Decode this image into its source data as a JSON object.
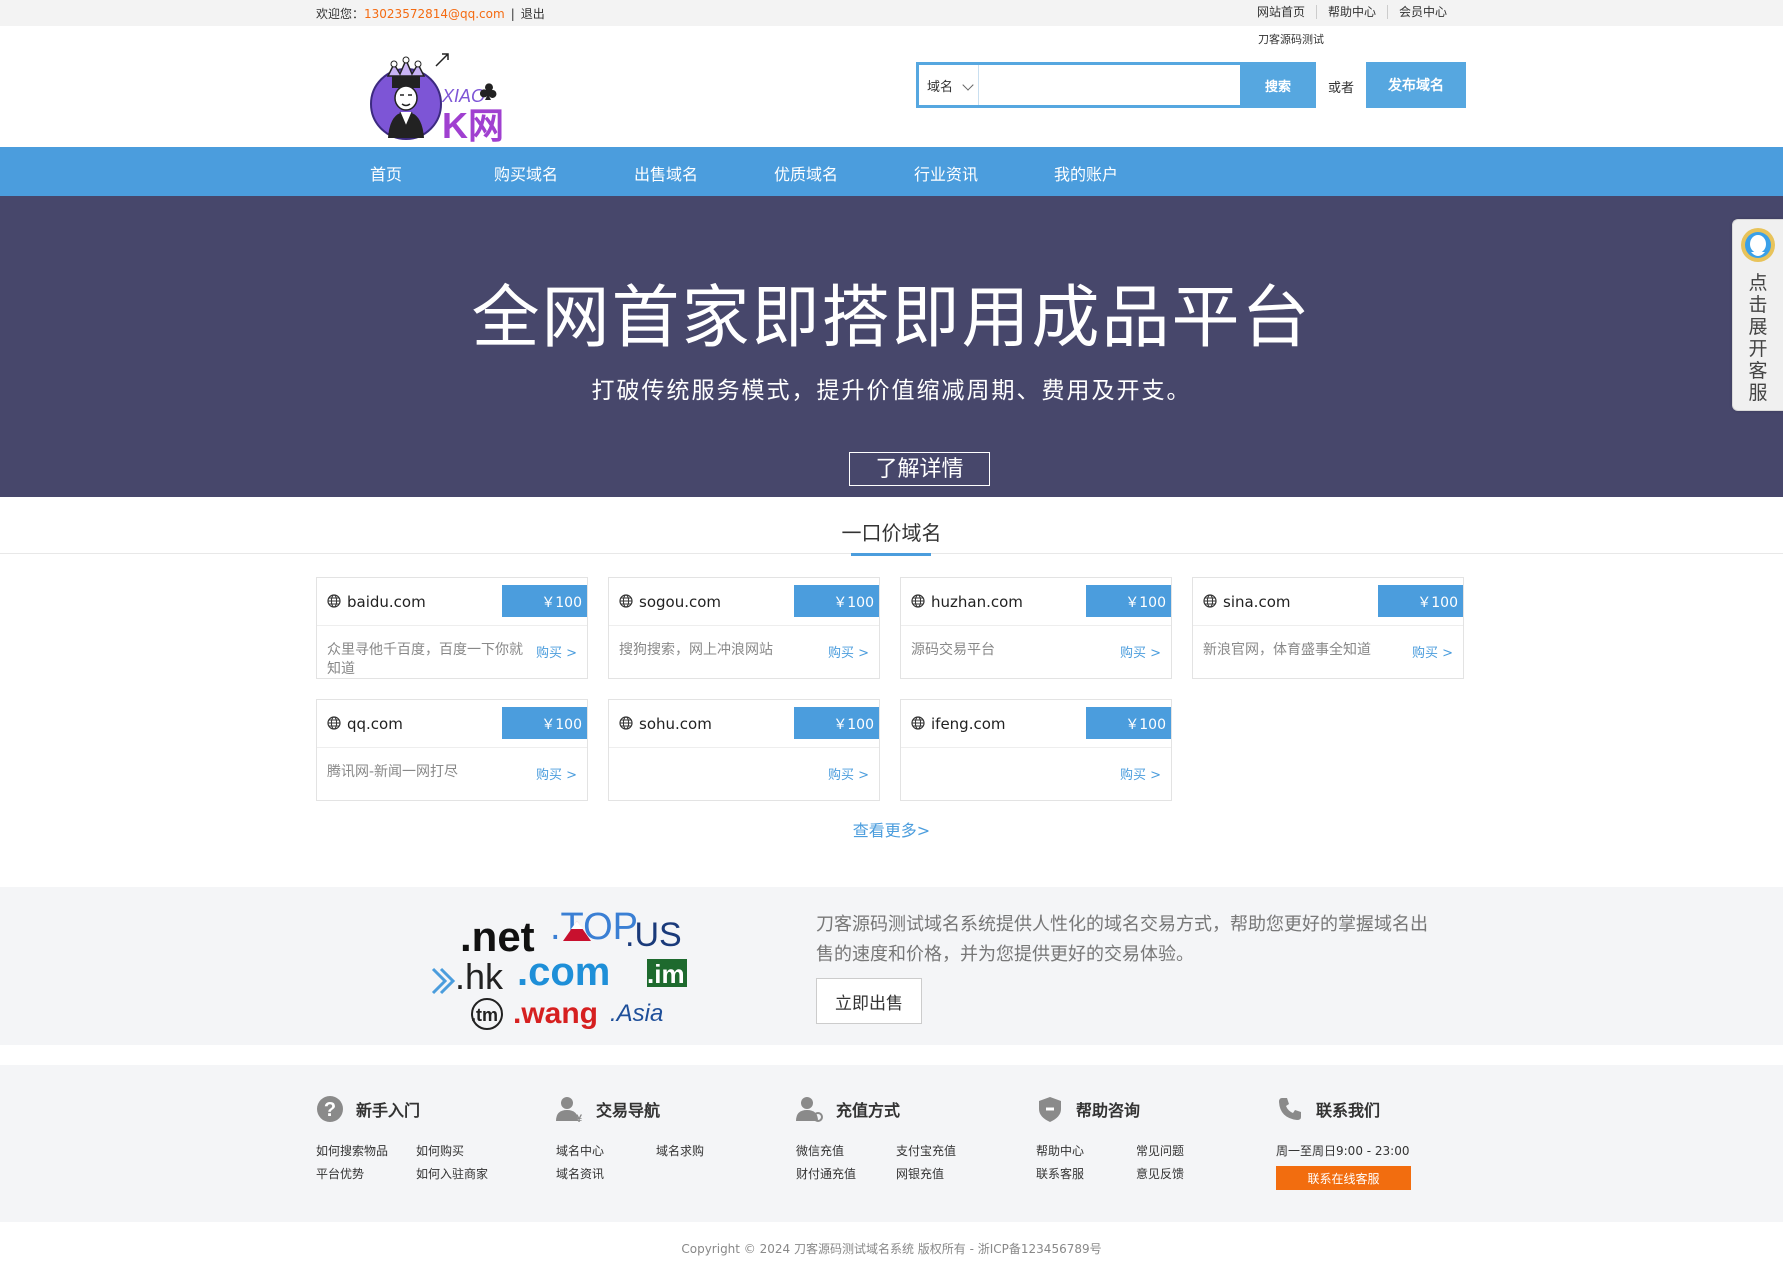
{
  "topbar": {
    "welcome": "欢迎您：",
    "email": "13023572814@qq.com",
    "separator": "|",
    "logout": "退出",
    "links": [
      "网站首页",
      "帮助中心",
      "会员中心"
    ]
  },
  "header": {
    "logo_text_top": "XIAO",
    "logo_text_main": "K网",
    "search_note": "刀客源码测试",
    "search_type": "域名",
    "search_value": "",
    "search_button": "搜索",
    "or_text": "或者",
    "publish_button": "发布域名"
  },
  "nav": {
    "items": [
      "首页",
      "购买域名",
      "出售域名",
      "优质域名",
      "行业资讯",
      "我的账户"
    ]
  },
  "banner": {
    "title": "全网首家即搭即用成品平台",
    "subtitle": "打破传统服务模式，提升价值缩减周期、费用及开支。",
    "button": "了解详情"
  },
  "section": {
    "title": "一口价域名",
    "see_more": "查看更多>"
  },
  "domains": [
    {
      "name": "baidu.com",
      "price": "￥100",
      "desc": "众里寻他千百度，百度一下你就知道",
      "buy": "购买 >"
    },
    {
      "name": "sogou.com",
      "price": "￥100",
      "desc": "搜狗搜索，网上冲浪网站",
      "buy": "购买 >"
    },
    {
      "name": "huzhan.com",
      "price": "￥100",
      "desc": "源码交易平台",
      "buy": "购买 >"
    },
    {
      "name": "sina.com",
      "price": "￥100",
      "desc": "新浪官网，体育盛事全知道",
      "buy": "购买 >"
    },
    {
      "name": "qq.com",
      "price": "￥100",
      "desc": "腾讯网-新闻一网打尽",
      "buy": "购买 >"
    },
    {
      "name": "sohu.com",
      "price": "￥100",
      "desc": "",
      "buy": "购买 >"
    },
    {
      "name": "ifeng.com",
      "price": "￥100",
      "desc": "",
      "buy": "购买 >"
    }
  ],
  "promo": {
    "art_labels": [
      ".net",
      ".TOP",
      ".US",
      ".hk",
      ".com",
      ".im",
      ".tm",
      ".wang",
      ".Asia"
    ],
    "text": "刀客源码测试域名系统提供人性化的域名交易方式，帮助您更好的掌握域名出售的速度和价格，并为您提供更好的交易体验。",
    "button": "立即出售"
  },
  "footer": {
    "columns": [
      {
        "title": "新手入门",
        "icon": "question-icon",
        "links": [
          "如何搜索物品",
          "如何购买",
          "平台优势",
          "如何入驻商家"
        ]
      },
      {
        "title": "交易导航",
        "icon": "user-money-icon",
        "links": [
          "域名中心",
          "域名求购",
          "域名资讯"
        ]
      },
      {
        "title": "充值方式",
        "icon": "user-settings-icon",
        "links": [
          "微信充值",
          "支付宝充值",
          "财付通充值",
          "网银充值"
        ]
      },
      {
        "title": "帮助咨询",
        "icon": "shield-icon",
        "links": [
          "帮助中心",
          "常见问题",
          "联系客服",
          "意见反馈"
        ]
      },
      {
        "title": "联系我们",
        "icon": "phone-icon",
        "hours": "周一至周日9:00 - 23:00",
        "button": "联系在线客服"
      }
    ],
    "copyright": "Copyright © 2024 刀客源码测试域名系统 版权所有 - 浙ICP备123456789号"
  },
  "kefu": {
    "text": "点击展开客服"
  },
  "colors": {
    "accent": "#4b9ddd",
    "banner_bg": "#47476b",
    "email": "#f46b12",
    "online_button": "#f26d0f"
  }
}
